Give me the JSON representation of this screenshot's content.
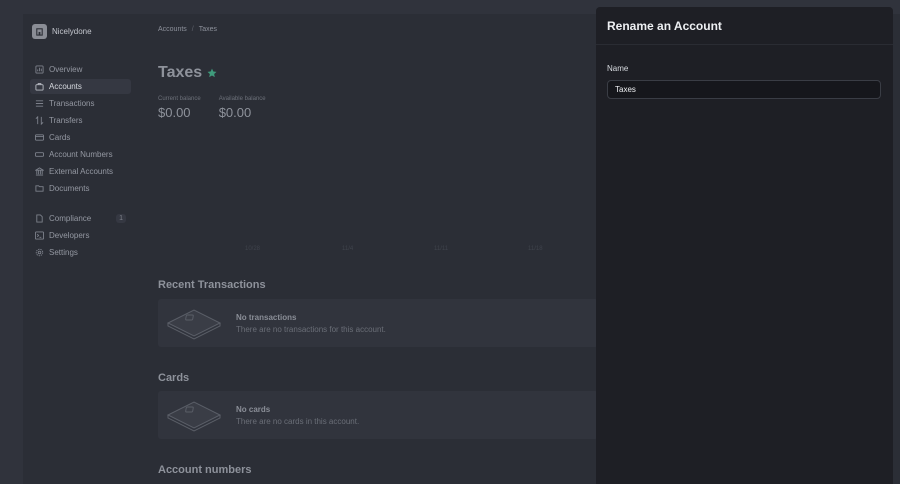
{
  "brand": {
    "name": "Nicelydone",
    "logo_icon": "building-icon"
  },
  "sidebar": {
    "items": [
      {
        "label": "Overview",
        "icon": "overview-icon",
        "active": false
      },
      {
        "label": "Accounts",
        "icon": "briefcase-icon",
        "active": true
      },
      {
        "label": "Transactions",
        "icon": "list-icon",
        "active": false
      },
      {
        "label": "Transfers",
        "icon": "arrows-icon",
        "active": false
      },
      {
        "label": "Cards",
        "icon": "card-icon",
        "active": false
      },
      {
        "label": "Account Numbers",
        "icon": "hash-icon",
        "active": false
      },
      {
        "label": "External Accounts",
        "icon": "bank-icon",
        "active": false
      },
      {
        "label": "Documents",
        "icon": "folder-icon",
        "active": false
      }
    ],
    "secondary_items": [
      {
        "label": "Compliance",
        "icon": "document-icon",
        "badge": "1"
      },
      {
        "label": "Developers",
        "icon": "terminal-icon"
      },
      {
        "label": "Settings",
        "icon": "gear-icon"
      }
    ]
  },
  "breadcrumb": {
    "parent": "Accounts",
    "separator": "/",
    "current": "Taxes"
  },
  "page": {
    "title": "Taxes",
    "favorite_color": "#3f9b7c"
  },
  "balances": {
    "current_label": "Current balance",
    "current_value": "$0.00",
    "available_label": "Available balance",
    "available_value": "$0.00"
  },
  "chart": {
    "ticks": [
      "10/28",
      "11/4",
      "11/11",
      "11/18"
    ]
  },
  "recent_transactions": {
    "title": "Recent Transactions",
    "empty_title": "No transactions",
    "empty_desc": "There are no transactions for this account."
  },
  "cards": {
    "title": "Cards",
    "empty_title": "No cards",
    "empty_desc": "There are no cards in this account."
  },
  "account_numbers": {
    "title": "Account numbers"
  },
  "panel": {
    "title": "Rename an Account",
    "name_label": "Name",
    "name_value": "Taxes"
  }
}
